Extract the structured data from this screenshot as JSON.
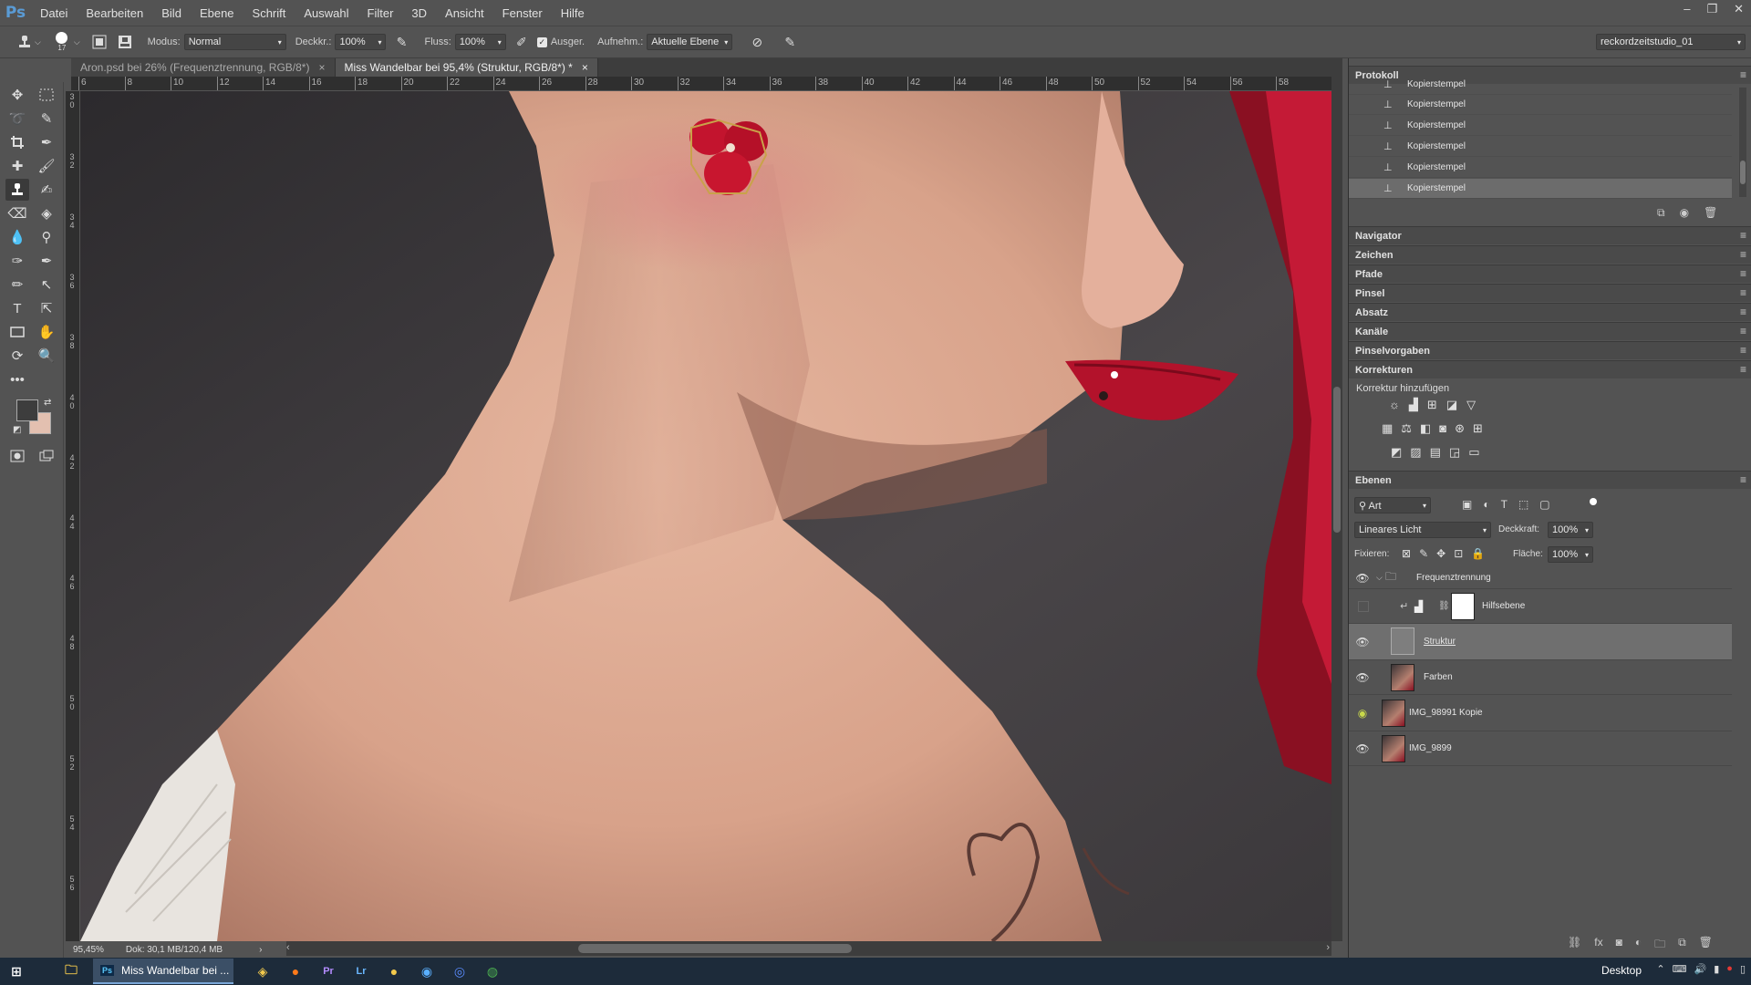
{
  "app": {
    "logo": "Ps",
    "menu": [
      "Datei",
      "Bearbeiten",
      "Bild",
      "Ebene",
      "Schrift",
      "Auswahl",
      "Filter",
      "3D",
      "Ansicht",
      "Fenster",
      "Hilfe"
    ],
    "window_controls": [
      "–",
      "❐",
      "✕"
    ]
  },
  "options": {
    "brush_size": "17",
    "mode_label": "Modus:",
    "mode_value": "Normal",
    "opacity_label": "Deckkr.:",
    "opacity_value": "100%",
    "flow_label": "Fluss:",
    "flow_value": "100%",
    "aligned_label": "Ausger.",
    "aligned_checked": true,
    "sample_label": "Aufnehm.:",
    "sample_value": "Aktuelle Ebene",
    "workspace": "reckordzeitstudio_01"
  },
  "tabs": [
    {
      "label": "Aron.psd bei 26% (Frequenztrennung, RGB/8*)",
      "active": false
    },
    {
      "label": "Miss Wandelbar bei 95,4% (Struktur, RGB/8*) *",
      "active": true
    }
  ],
  "rulers": {
    "top": [
      "6",
      "8",
      "10",
      "12",
      "14",
      "16",
      "18",
      "20",
      "22",
      "24",
      "26",
      "28",
      "30",
      "32",
      "34",
      "36",
      "38",
      "40",
      "42",
      "44",
      "46",
      "48",
      "50",
      "52",
      "54",
      "56",
      "58"
    ],
    "left": [
      "30",
      "32",
      "34",
      "36",
      "38",
      "40",
      "42",
      "44",
      "46",
      "48",
      "50",
      "52",
      "54",
      "56"
    ]
  },
  "status": {
    "zoom": "95,45%",
    "doc": "Dok: 30,1 MB/120,4 MB"
  },
  "panels": {
    "history": {
      "title": "Protokoll",
      "items": [
        "Kopierstempel",
        "Kopierstempel",
        "Kopierstempel",
        "Kopierstempel",
        "Kopierstempel",
        "Kopierstempel"
      ],
      "selected_index": 5
    },
    "collapsed": [
      "Navigator",
      "Zeichen",
      "Pfade",
      "Pinsel",
      "Absatz",
      "Kanäle",
      "Pinselvorgaben"
    ],
    "adjustments": {
      "title": "Korrekturen",
      "subtitle": "Korrektur hinzufügen"
    },
    "layers": {
      "title": "Ebenen",
      "filter_value": "Art",
      "blend_mode": "Lineares Licht",
      "opacity_label": "Deckkraft:",
      "opacity_value": "100%",
      "lock_label": "Fixieren:",
      "fill_label": "Fläche:",
      "fill_value": "100%",
      "items": [
        {
          "name": "Frequenztrennung",
          "type": "group",
          "visible": true
        },
        {
          "name": "Hilfsebene",
          "type": "adjustment",
          "visible": false
        },
        {
          "name": "Struktur",
          "type": "layer",
          "visible": true,
          "selected": true
        },
        {
          "name": "Farben",
          "type": "layer",
          "visible": true
        },
        {
          "name": "IMG_98991 Kopie",
          "type": "layer",
          "visible": true
        },
        {
          "name": "IMG_9899",
          "type": "layer",
          "visible": true
        }
      ]
    }
  },
  "taskbar": {
    "active_window": "Miss Wandelbar bei ...",
    "desktop_label": "Desktop"
  },
  "colors": {
    "foreground": "#3d3d3d",
    "background": "#e3c0b0",
    "accent_red": "#c4122a"
  }
}
